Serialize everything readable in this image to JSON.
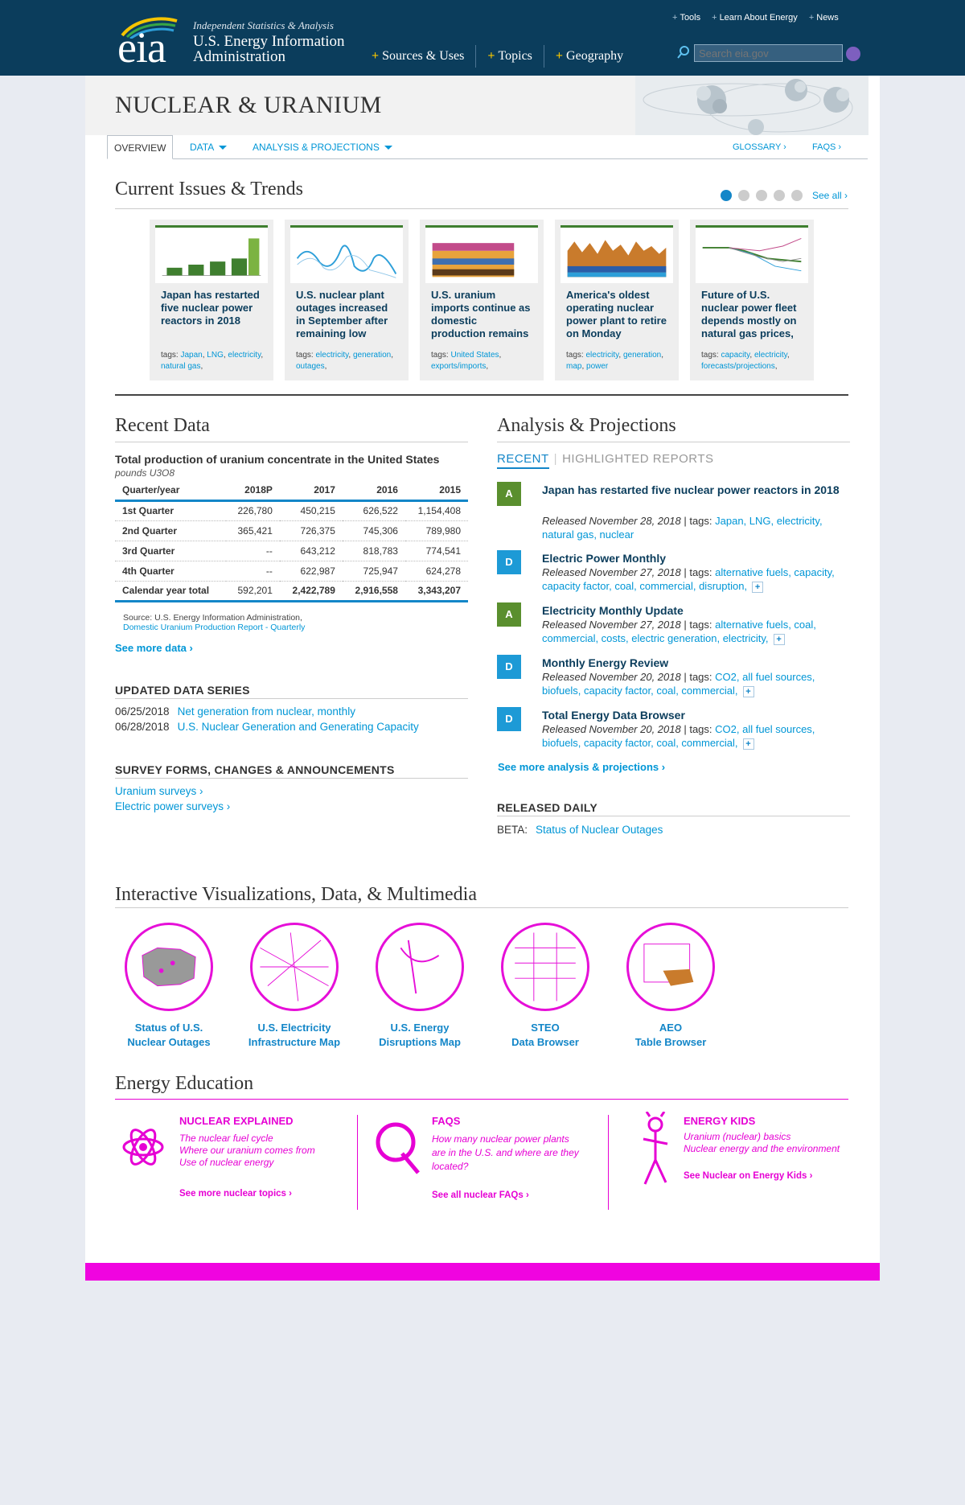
{
  "header": {
    "logo_text": "eia",
    "tagline": "Independent Statistics & Analysis",
    "org_line1": "U.S. Energy Information",
    "org_line2": "Administration",
    "nav": [
      "Sources & Uses",
      "Topics",
      "Geography"
    ],
    "utility": [
      "Tools",
      "Learn About Energy",
      "News"
    ],
    "search_placeholder": "Search eia.gov"
  },
  "page": {
    "title": "NUCLEAR & URANIUM",
    "tabs": {
      "overview": "OVERVIEW",
      "data": "DATA",
      "analysis": "ANALYSIS & PROJECTIONS",
      "glossary": "GLOSSARY ›",
      "faqs": "FAQS ›"
    }
  },
  "trends": {
    "heading": "Current Issues & Trends",
    "see_all": "See all ›",
    "cards": [
      {
        "title": "Japan has restarted five nuclear power reactors in 2018",
        "tags_label": "tags:",
        "tags": [
          "Japan",
          "LNG",
          "electricity",
          "natural gas"
        ]
      },
      {
        "title": "U.S. nuclear plant outages increased in September after remaining low",
        "tags_label": "tags:",
        "tags": [
          "electricity",
          "generation",
          "outages"
        ]
      },
      {
        "title": "U.S. uranium imports continue as domestic production remains",
        "tags_label": "tags:",
        "tags": [
          "United States",
          "exports/imports"
        ]
      },
      {
        "title": "America's oldest operating nuclear power plant to retire on Monday",
        "tags_label": "tags:",
        "tags": [
          "electricity",
          "generation",
          "map",
          "power"
        ]
      },
      {
        "title": "Future of U.S. nuclear power fleet depends mostly on natural gas prices,",
        "tags_label": "tags:",
        "tags": [
          "capacity",
          "electricity",
          "forecasts/projections"
        ]
      }
    ]
  },
  "recent": {
    "heading": "Recent Data",
    "table_title": "Total production of uranium concentrate in the United States",
    "unit": "pounds U3O8",
    "columns": [
      "Quarter/year",
      "2018P",
      "2017",
      "2016",
      "2015"
    ],
    "rows": [
      [
        "1st Quarter",
        "226,780",
        "450,215",
        "626,522",
        "1,154,408"
      ],
      [
        "2nd Quarter",
        "365,421",
        "726,375",
        "745,306",
        "789,980"
      ],
      [
        "3rd Quarter",
        "--",
        "643,212",
        "818,783",
        "774,541"
      ],
      [
        "4th Quarter",
        "--",
        "622,987",
        "725,947",
        "624,278"
      ],
      [
        "Calendar year total",
        "592,201",
        "2,422,789",
        "2,916,558",
        "3,343,207"
      ]
    ],
    "source": "Source: U.S. Energy Information Administration,",
    "source_link": "Domestic Uranium Production Report - Quarterly",
    "see_more": "See more data ›"
  },
  "updated": {
    "heading": "UPDATED DATA SERIES",
    "items": [
      {
        "date": "06/25/2018",
        "label": "Net generation from nuclear, monthly"
      },
      {
        "date": "06/28/2018",
        "label": "U.S. Nuclear Generation and Generating Capacity"
      }
    ]
  },
  "survey": {
    "heading": "SURVEY FORMS, CHANGES & ANNOUNCEMENTS",
    "items": [
      "Uranium surveys ›",
      "Electric power surveys ›"
    ]
  },
  "analysis": {
    "heading": "Analysis & Projections",
    "tab_recent": "RECENT",
    "tab_highlighted": "HIGHLIGHTED REPORTS",
    "items": [
      {
        "badge": "A",
        "color": "#5a8f2e",
        "title": "Japan has restarted five nuclear power reactors in 2018",
        "released": "Released November 28, 2018",
        "tags": "Japan, LNG, electricity, natural gas, nuclear"
      },
      {
        "badge": "D",
        "color": "#1d9ad6",
        "title": "Electric Power Monthly",
        "released": "Released November 27, 2018",
        "tags": "alternative fuels, capacity, capacity factor, coal, commercial, disruption,"
      },
      {
        "badge": "A",
        "color": "#5a8f2e",
        "title": "Electricity Monthly Update",
        "released": "Released November 27, 2018",
        "tags": "alternative fuels, coal, commercial, costs, electric generation, electricity,"
      },
      {
        "badge": "D",
        "color": "#1d9ad6",
        "title": "Monthly Energy Review",
        "released": "Released November 20, 2018",
        "tags": "CO2, all fuel sources, biofuels, capacity factor, coal, commercial,"
      },
      {
        "badge": "D",
        "color": "#1d9ad6",
        "title": "Total Energy Data Browser",
        "released": "Released November 20, 2018",
        "tags": "CO2, all fuel sources, biofuels, capacity factor, coal, commercial,"
      }
    ],
    "tags_sep": " | tags: ",
    "see_more": "See more analysis & projections ›"
  },
  "daily": {
    "heading": "RELEASED DAILY",
    "label": "BETA:",
    "link": "Status of Nuclear Outages"
  },
  "viz": {
    "heading": "Interactive Visualizations, Data, & Multimedia",
    "items": [
      {
        "l1": "Status of U.S.",
        "l2": "Nuclear Outages"
      },
      {
        "l1": "U.S. Electricity",
        "l2": "Infrastructure Map"
      },
      {
        "l1": "U.S. Energy",
        "l2": "Disruptions Map"
      },
      {
        "l1": "STEO",
        "l2": "Data Browser"
      },
      {
        "l1": "AEO",
        "l2": "Table Browser"
      }
    ]
  },
  "edu": {
    "heading": "Energy Education",
    "cols": [
      {
        "title": "NUCLEAR EXPLAINED",
        "lines": [
          "The nuclear fuel cycle",
          "Where our uranium comes from",
          "Use of nuclear energy"
        ],
        "more": "See more nuclear topics ›"
      },
      {
        "title": "FAQS",
        "lines": [
          "How many nuclear power plants",
          "are in the U.S. and where are they",
          "located?"
        ],
        "more": "See all nuclear FAQs ›"
      },
      {
        "title": "ENERGY KIDS",
        "lines": [
          "Uranium (nuclear) basics",
          "Nuclear energy and the environment"
        ],
        "more": "See Nuclear on Energy Kids ›"
      }
    ]
  }
}
